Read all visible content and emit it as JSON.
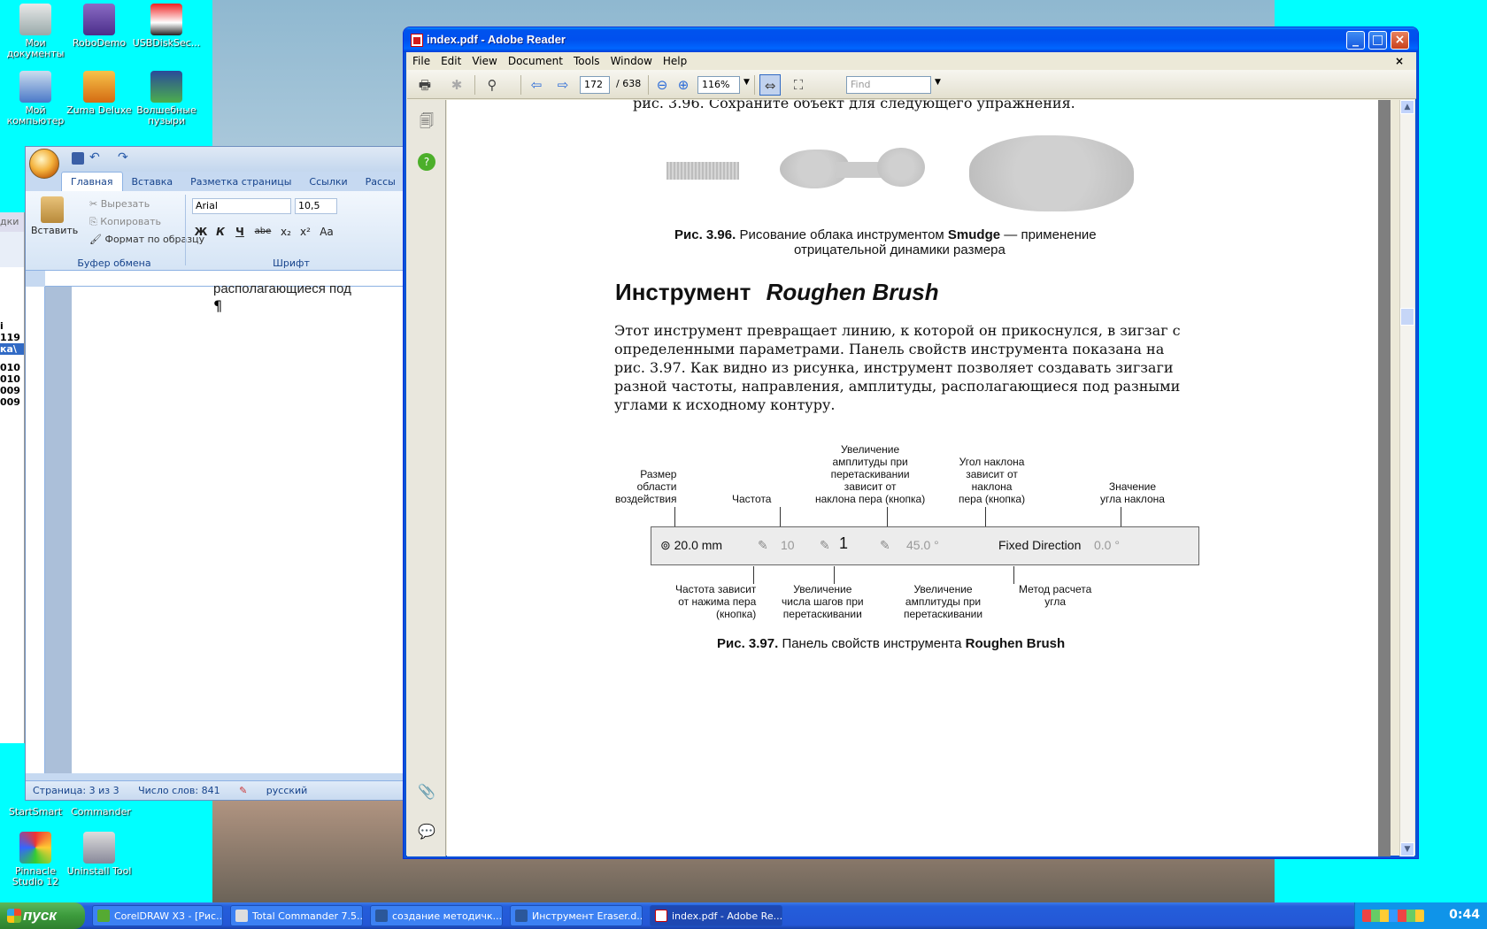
{
  "desktop": {
    "icons": [
      {
        "label": "Мои документы"
      },
      {
        "label": "RoboDemo"
      },
      {
        "label": "USBDiskSec..."
      },
      {
        "label": "Мой компьютер"
      },
      {
        "label": "Zuma Deluxe"
      },
      {
        "label": "Волшебные пузыри"
      },
      {
        "label": "StartSmart"
      },
      {
        "label": "Commander"
      },
      {
        "label": "Pinnacle Studio 12"
      },
      {
        "label": "Uninstall Tool"
      }
    ]
  },
  "taskbar": {
    "start_label": "пуск",
    "tasks": [
      {
        "label": "CorelDRAW X3 - [Рис..."
      },
      {
        "label": "Total Commander 7.5..."
      },
      {
        "label": "создание методичк..."
      },
      {
        "label": "Инструмент Eraser.d..."
      },
      {
        "label": "index.pdf - Adobe Re..."
      }
    ],
    "clock": "0:44"
  },
  "word": {
    "tabs": [
      "Главная",
      "Вставка",
      "Разметка страницы",
      "Ссылки",
      "Рассы"
    ],
    "clipboard": {
      "paste": "Вставить",
      "cut": "Вырезать",
      "copy": "Копировать",
      "format_painter": "Формат по образцу",
      "group_label": "Буфер обмена"
    },
    "font": {
      "name": "Arial",
      "size": "10,5",
      "group_label": "Шрифт",
      "bold": "Ж",
      "italic": "К",
      "underline": "Ч",
      "strike": "abe",
      "sub": "x₂",
      "sup": "x²",
      "case": "Aa"
    },
    "doc_text": "располагающиеся под",
    "pilcrow": "¶",
    "status": {
      "page": "Страница: 3 из 3",
      "words": "Число слов: 841",
      "lang": "русский"
    },
    "side_fragments": [
      "дки",
      "i",
      "119",
      "ка\\",
      "010",
      "010",
      "009",
      "009"
    ]
  },
  "adobe": {
    "title": "index.pdf - Adobe Reader",
    "menu": [
      "File",
      "Edit",
      "View",
      "Document",
      "Tools",
      "Window",
      "Help"
    ],
    "toolbar": {
      "page_current": "172",
      "page_total": "/ 638",
      "zoom": "116%",
      "find_placeholder": "Find"
    },
    "page": {
      "top_line": "рис. 3.96. Сохраните объект для следующего упражнения.",
      "fig96_bold": "Рис. 3.96.",
      "fig96_text": "Рисование облака инструментом",
      "fig96_tool": "Smudge",
      "fig96_text2": "— применение",
      "fig96_line2": "отрицательной динамики размера",
      "heading_plain": "Инструмент",
      "heading_italic": "Roughen Brush",
      "paragraph_lines": [
        "Этот инструмент превращает линию, к которой он прикоснулся, в зигзаг с",
        "определенными параметрами. Панель свойств инструмента показана на",
        "рис. 3.97. Как видно из рисунка, инструмент позволяет создавать зигзаги",
        "разной частоты, направления, амплитуды, располагающиеся под разными",
        "углами к исходному контуру."
      ],
      "annotations": {
        "size_area": [
          "Размер",
          "области",
          "воздействия"
        ],
        "frequency": "Частота",
        "amp_increase": [
          "Увеличение",
          "амплитуды при",
          "перетаскивании",
          "зависит от",
          "наклона пера (кнопка)"
        ],
        "tilt_angle": [
          "Угол наклона",
          "зависит от",
          "наклона",
          "пера (кнопка)"
        ],
        "angle_value": [
          "Значение",
          "угла наклона"
        ],
        "freq_pressure": [
          "Частота зависит",
          "от нажима пера",
          "(кнопка)"
        ],
        "steps_increase": [
          "Увеличение",
          "числа шагов при",
          "перетаскивании"
        ],
        "amp_drag": [
          "Увеличение",
          "амплитуды при",
          "перетаскивании"
        ],
        "angle_method": [
          "Метод расчета",
          "угла"
        ]
      },
      "propbar": {
        "size": "20.0 mm",
        "freq": "10",
        "steps": "1",
        "angle": "45.0 °",
        "direction": "Fixed Direction",
        "value": "0.0 °"
      },
      "fig97_bold": "Рис. 3.97.",
      "fig97_text": "Панель свойств инструмента",
      "fig97_tool": "Roughen Brush"
    }
  }
}
